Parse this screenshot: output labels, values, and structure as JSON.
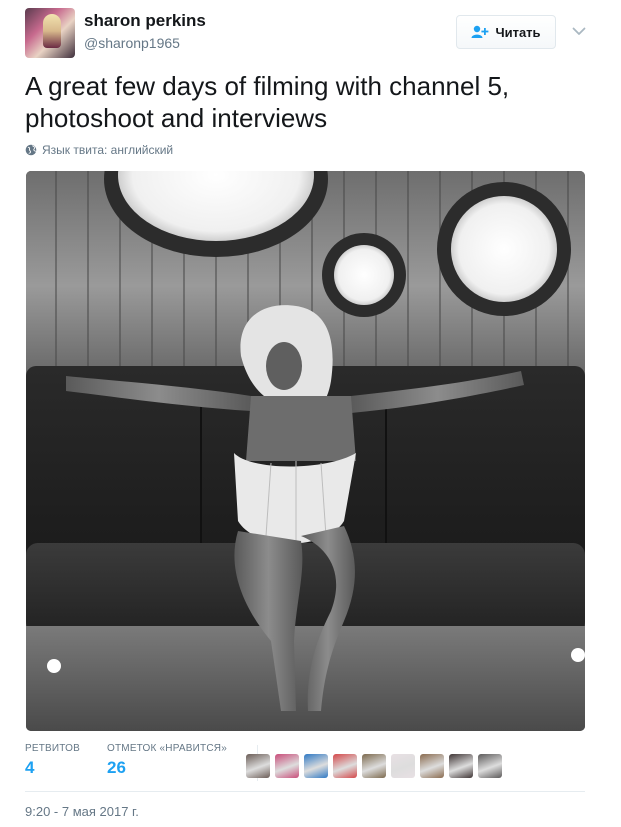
{
  "user": {
    "display_name": "sharon perkins",
    "handle": "@sharonp1965"
  },
  "header": {
    "follow_label": "Читать",
    "follow_icon": "add-user-icon",
    "more_icon": "chevron-down-icon"
  },
  "tweet": {
    "text": "A great few days of filming with channel 5, photoshoot and interviews",
    "language_note": "Язык твита: английский",
    "language_icon": "globe-icon",
    "photo_description_icon": "photo"
  },
  "stats": {
    "retweets_label": "РЕТВИТОВ",
    "retweets_value": "4",
    "likes_label": "ОТМЕТОК «НРАВИТСЯ»",
    "likes_value": "26"
  },
  "likers": [
    {
      "name": "liker-avatar-1",
      "color": "#6b5d57"
    },
    {
      "name": "liker-avatar-2",
      "color": "#c94d7a"
    },
    {
      "name": "liker-avatar-3",
      "color": "#2f79c4"
    },
    {
      "name": "liker-avatar-4",
      "color": "#d4484a"
    },
    {
      "name": "liker-avatar-5",
      "color": "#7d6a4e"
    },
    {
      "name": "liker-avatar-6",
      "color": "#e8e0e4"
    },
    {
      "name": "liker-avatar-7",
      "color": "#8a6b4f"
    },
    {
      "name": "liker-avatar-8",
      "color": "#3f3535"
    },
    {
      "name": "liker-avatar-9",
      "color": "#5c5a5a"
    }
  ],
  "timestamp": "9:20 - 7 мая 2017 г.",
  "colors": {
    "accent": "#1da1f2",
    "secondary_text": "#657786",
    "primary_text": "#14171a"
  }
}
